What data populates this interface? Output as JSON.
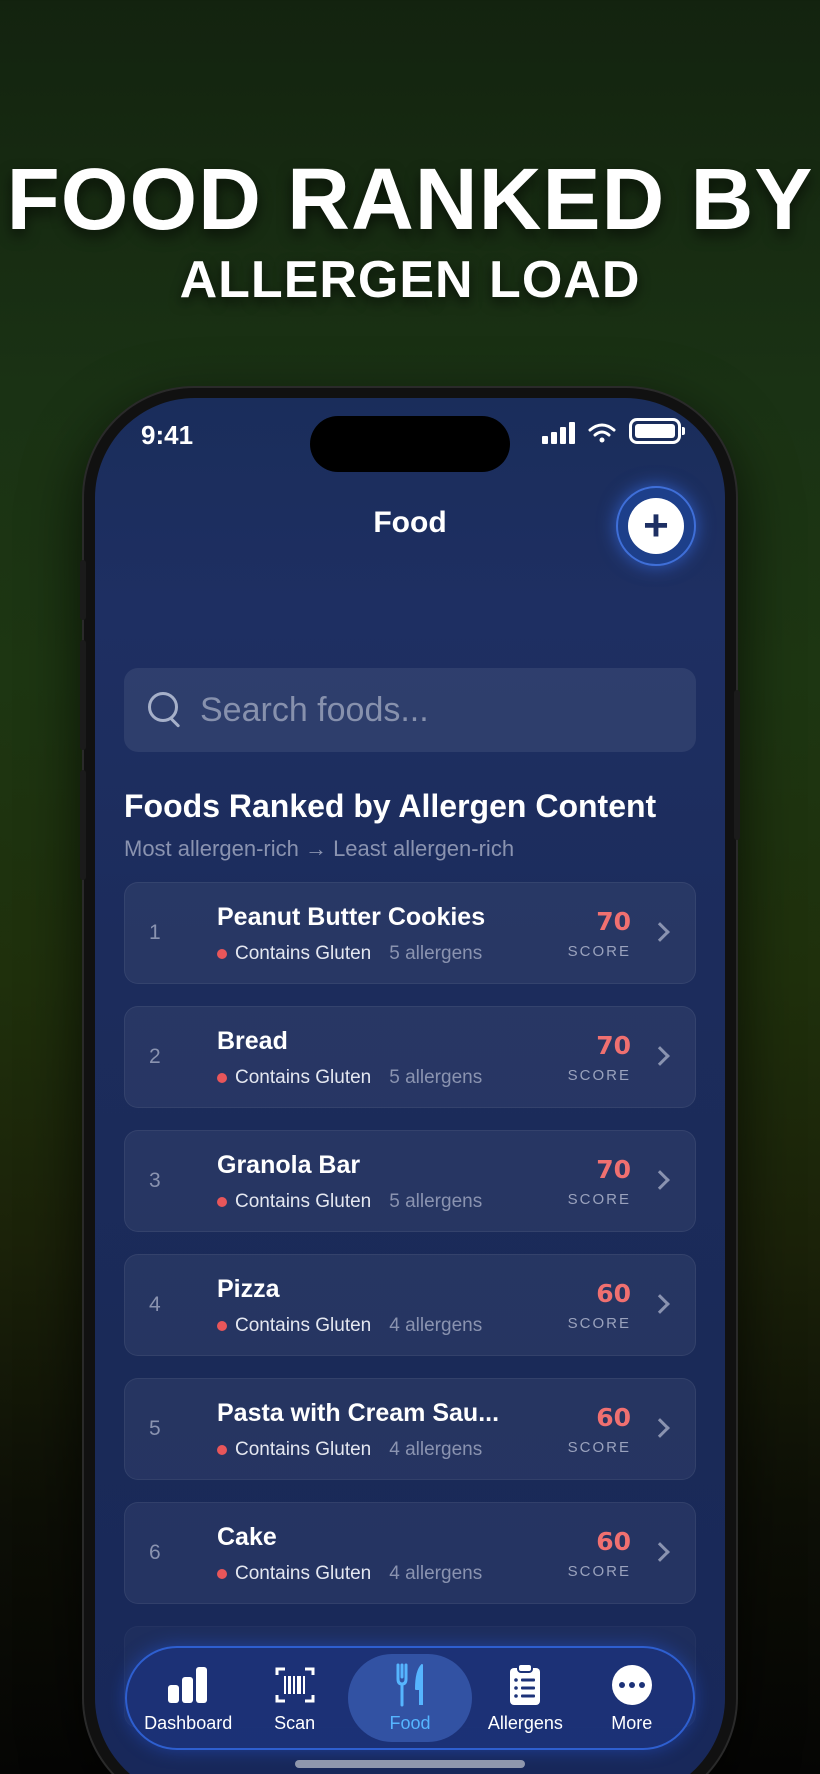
{
  "headline": "FOOD RANKED BY",
  "subheadline": "ALLERGEN LOAD",
  "status": {
    "time": "9:41"
  },
  "nav": {
    "title": "Food",
    "add_icon": "plus-icon"
  },
  "search": {
    "placeholder": "Search foods..."
  },
  "section": {
    "title": "Foods Ranked by Allergen Content",
    "subtitle": "Most allergen-rich → Least allergen-rich"
  },
  "foods": [
    {
      "rank": "1",
      "name": "Peanut Butter Cookies",
      "tag": "Contains Gluten",
      "allergens": "5 allergens",
      "score": "70",
      "score_label": "SCORE"
    },
    {
      "rank": "2",
      "name": "Bread",
      "tag": "Contains Gluten",
      "allergens": "5 allergens",
      "score": "70",
      "score_label": "SCORE"
    },
    {
      "rank": "3",
      "name": "Granola Bar",
      "tag": "Contains Gluten",
      "allergens": "5 allergens",
      "score": "70",
      "score_label": "SCORE"
    },
    {
      "rank": "4",
      "name": "Pizza",
      "tag": "Contains Gluten",
      "allergens": "4 allergens",
      "score": "60",
      "score_label": "SCORE"
    },
    {
      "rank": "5",
      "name": "Pasta with Cream Sau...",
      "tag": "Contains Gluten",
      "allergens": "4 allergens",
      "score": "60",
      "score_label": "SCORE"
    },
    {
      "rank": "6",
      "name": "Cake",
      "tag": "Contains Gluten",
      "allergens": "4 allergens",
      "score": "60",
      "score_label": "SCORE"
    }
  ],
  "tabs": [
    {
      "label": "Dashboard",
      "icon": "bar-chart-icon"
    },
    {
      "label": "Scan",
      "icon": "barcode-scan-icon"
    },
    {
      "label": "Food",
      "icon": "fork-knife-icon",
      "active": true
    },
    {
      "label": "Allergens",
      "icon": "clipboard-list-icon"
    },
    {
      "label": "More",
      "icon": "more-dots-icon"
    }
  ],
  "colors": {
    "accent": "#56b5ff",
    "score": "#f07070",
    "gluten_dot": "#e8565a",
    "screen_bg": "#1c2c5c"
  }
}
